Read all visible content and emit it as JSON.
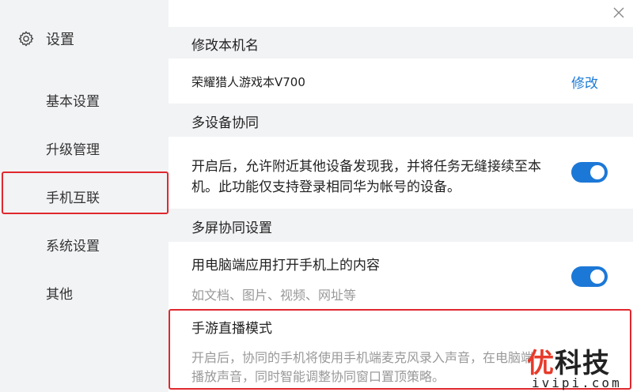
{
  "sidebar": {
    "title": "设置",
    "items": [
      {
        "label": "基本设置"
      },
      {
        "label": "升级管理"
      },
      {
        "label": "手机互联"
      },
      {
        "label": "系统设置"
      },
      {
        "label": "其他"
      }
    ]
  },
  "sections": {
    "rename": {
      "title": "修改本机名",
      "device_name": "荣耀猎人游戏本V700",
      "edit_link": "修改"
    },
    "multi_device": {
      "title": "多设备协同",
      "desc_line1": "开启后，允许附近其他设备发现我，并将任务无缝接续至本",
      "desc_line2": "机。此功能仅支持登录相同华为帐号的设备。",
      "toggle_on": true
    },
    "multi_screen": {
      "title": "多屏协同设置",
      "open_label": "用电脑端应用打开手机上的内容",
      "open_sub": "如文档、图片、视频、网址等",
      "open_toggle_on": true,
      "live_title": "手游直播模式",
      "live_desc_line1": "开启后，协同的手机将使用手机端麦克风录入声音，在电脑端",
      "live_desc_line2": "播放声音，同时智能调整协同窗口置顶策略。"
    }
  },
  "watermark": {
    "cn_part1": "优",
    "cn_part2": "科技",
    "url": "ivipi.com"
  },
  "colors": {
    "accent": "#1c78d7",
    "highlight": "#e0282e",
    "sidebar_bg": "#f2f3f5"
  }
}
